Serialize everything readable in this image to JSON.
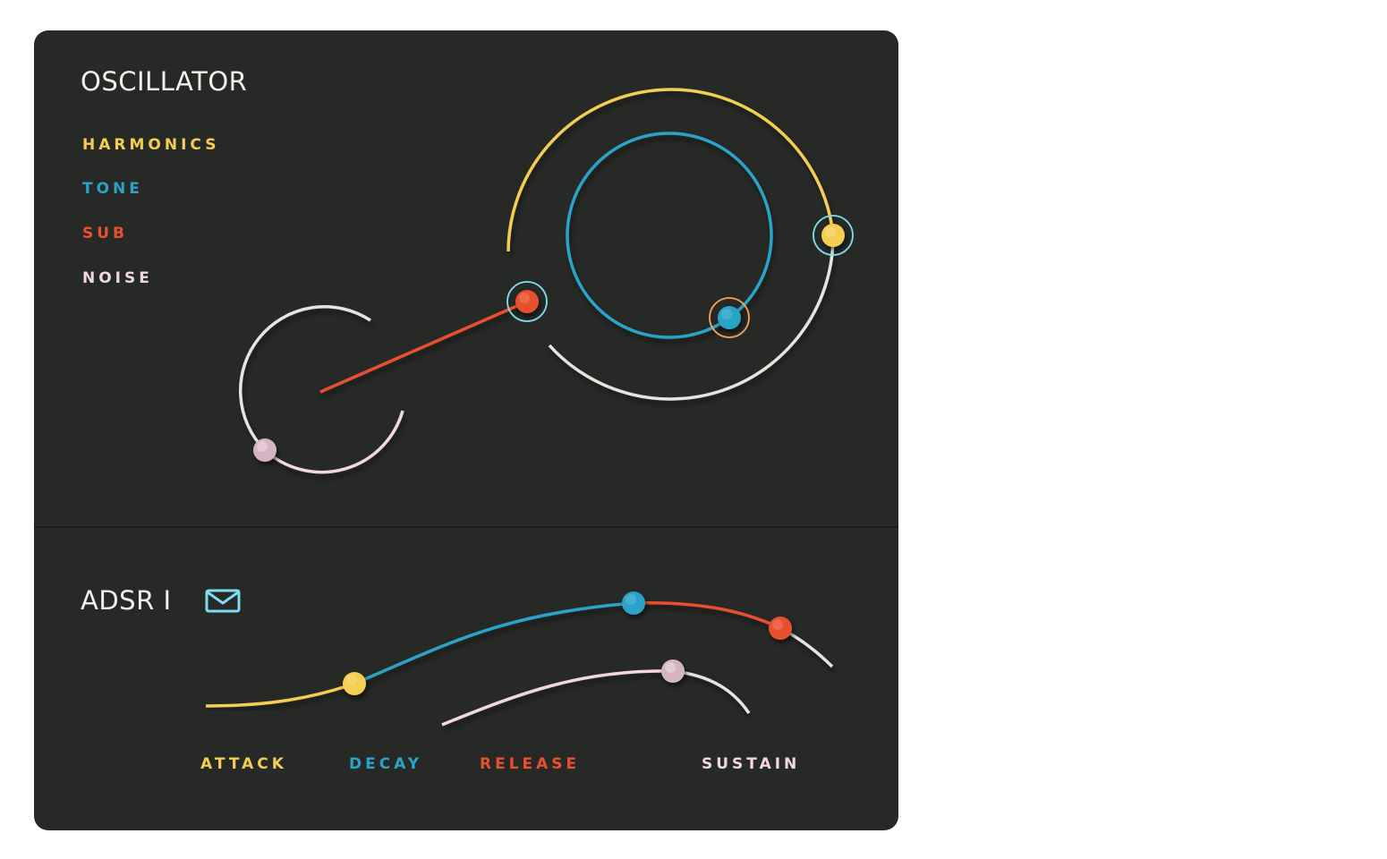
{
  "oscillator": {
    "title": "OSCILLATOR",
    "controls": [
      {
        "label": "HARMONICS",
        "color": "#f5cd52"
      },
      {
        "label": "TONE",
        "color": "#2aa3c9"
      },
      {
        "label": "SUB",
        "color": "#e8502f"
      },
      {
        "label": "NOISE",
        "color": "#f3d6e6"
      }
    ]
  },
  "adsr": {
    "title": "ADSR I",
    "icon": "mail-icon",
    "stages": [
      {
        "label": "ATTACK",
        "color": "#f5cd52"
      },
      {
        "label": "DECAY",
        "color": "#2aa3c9"
      },
      {
        "label": "RELEASE",
        "color": "#e8502f"
      },
      {
        "label": "SUSTAIN",
        "color": "#f3d6e6"
      }
    ]
  },
  "colors": {
    "panel_bg": "#262926",
    "track_neutral": "#e4e4e1",
    "ring_highlight": "#7fdcf0",
    "ring_orange": "#f0a45a",
    "icon_accent": "#7fdcf0"
  }
}
